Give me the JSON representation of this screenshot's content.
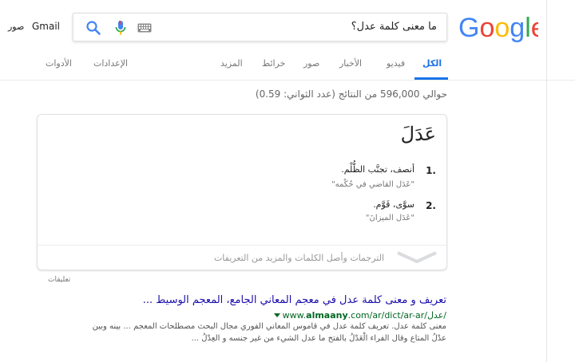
{
  "header": {
    "logo_text": "Google",
    "search_query": "ما معنى كلمة عدل؟",
    "gmail_link": "Gmail",
    "images_link": "صور"
  },
  "tabs": [
    {
      "label": "الكل",
      "active": true
    },
    {
      "label": "فيديو"
    },
    {
      "label": "الأخبار"
    },
    {
      "label": "صور"
    },
    {
      "label": "خرائط"
    },
    {
      "label": "المزيد"
    },
    {
      "label": "الإعدادات"
    },
    {
      "label": "الأدوات"
    }
  ],
  "results_stats": "حوالي 596,000 من النتائج (عدد الثواني: 0.59)",
  "dictionary_card": {
    "headword": "عَدَلَ",
    "definitions": [
      {
        "number": "1.",
        "text": "أنصف، تجنَّب الظُّلْم.",
        "example": "\"عَدَل القاضي في حُكْمه\""
      },
      {
        "number": "2.",
        "text": "سوَّى، قَوَّم.",
        "example": "\"عَدَل الميزانَ\""
      }
    ],
    "footer": "الترجمات وأصل الكلمات والمزيد من التعريفات"
  },
  "feedback_label": "تعليقات",
  "result": {
    "title": "تعريف و معنى كلمة عدل في معجم المعاني الجامع، المعجم الوسيط ...",
    "url_prefix": "www.",
    "url_domain": "almaany",
    "url_rest": ".com/ar/dict/ar-ar/عدل/",
    "snippet_line1": "معنى كلمة عدل. تعريف كلمة عدل في قاموس المعاني الفوري مجال البحث مصطلحات المعجم ... بينه وبين",
    "snippet_line2": "عدْلُ المتاع وقال الفراء الْعَدْلُ بالفتح ما عدل الشيء من غير جنسه و العِدْلُ ..."
  },
  "colors": {
    "link": "#1a0dab",
    "url_green": "#006621",
    "accent_blue": "#1a73e8",
    "logo_blue": "#4285F4",
    "logo_red": "#EA4335",
    "logo_yellow": "#FBBC05",
    "logo_green": "#34A853"
  },
  "icons": [
    "keyboard-icon",
    "microphone-icon",
    "search-icon",
    "chevron-down-icon"
  ]
}
